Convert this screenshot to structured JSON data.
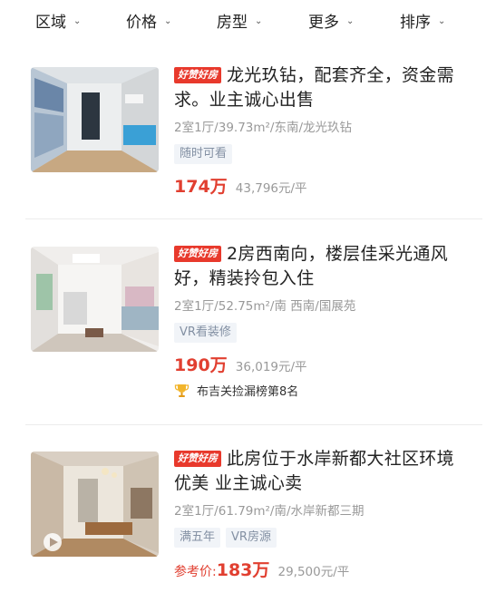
{
  "filters": [
    {
      "label": "区域"
    },
    {
      "label": "价格"
    },
    {
      "label": "房型"
    },
    {
      "label": "更多"
    },
    {
      "label": "排序"
    }
  ],
  "listings": [
    {
      "badge": "好赞好房",
      "title": "龙光玖钻，配套齐全，资金需求。业主诚心出售",
      "meta": "2室1厅/39.73m²/东南/龙光玖钻",
      "tags": [
        "随时可看"
      ],
      "price_prefix": "",
      "price": "174万",
      "unit_price": "43,796元/平",
      "rank": ""
    },
    {
      "badge": "好赞好房",
      "title": "2房西南向，楼层佳采光通风好，精装拎包入住",
      "meta": "2室1厅/52.75m²/南 西南/国展苑",
      "tags": [
        "VR看装修"
      ],
      "price_prefix": "",
      "price": "190万",
      "unit_price": "36,019元/平",
      "rank": "布吉关捡漏榜第8名"
    },
    {
      "badge": "好赞好房",
      "title": "此房位于水岸新都大社区环境优美 业主诚心卖",
      "meta": "2室1厅/61.79m²/南/水岸新都三期",
      "tags": [
        "满五年",
        "VR房源"
      ],
      "price_prefix": "参考价:",
      "price": "183万",
      "unit_price": "29,500元/平",
      "rank": ""
    }
  ],
  "colors": {
    "accent_red": "#e13f30",
    "badge_red": "#e8392c",
    "tag_bg": "#f1f4f8",
    "tag_text": "#8390a3",
    "muted_text": "#999999"
  },
  "icons": {
    "chevron": "chevron-down-icon",
    "rank": "trophy-icon"
  }
}
